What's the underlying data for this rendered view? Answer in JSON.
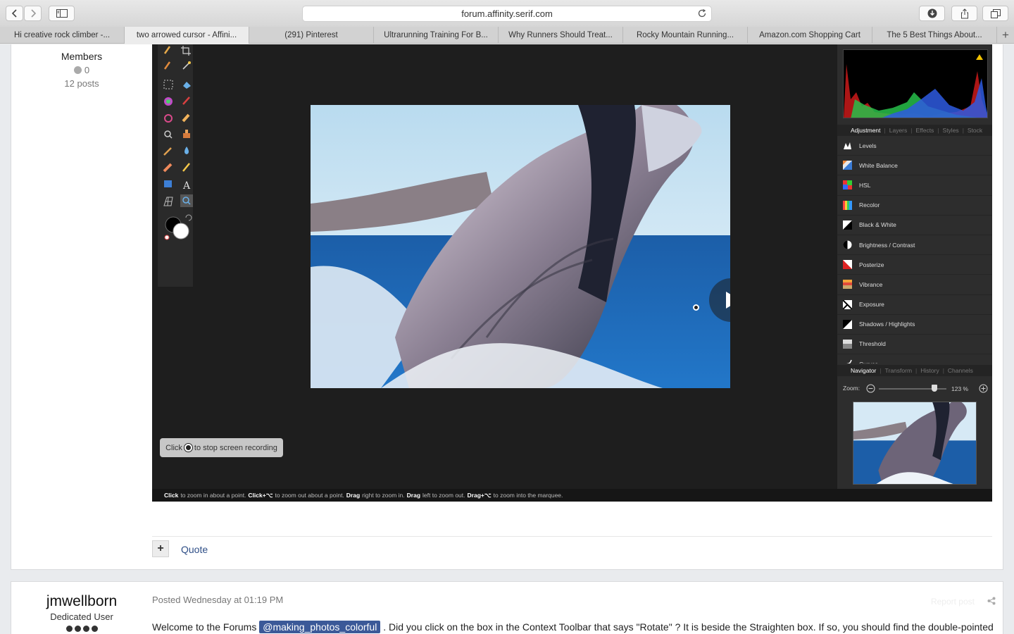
{
  "browser": {
    "url": "forum.affinity.serif.com",
    "tabs": [
      {
        "label": "Hi creative rock climber -...",
        "active": false
      },
      {
        "label": "two arrowed cursor - Affini...",
        "active": true
      },
      {
        "label": "(291) Pinterest",
        "active": false
      },
      {
        "label": "Ultrarunning Training For B...",
        "active": false
      },
      {
        "label": "Why Runners Should Treat...",
        "active": false
      },
      {
        "label": "Rocky Mountain Running...",
        "active": false
      },
      {
        "label": "Amazon.com Shopping Cart",
        "active": false
      },
      {
        "label": "The 5 Best Things About...",
        "active": false
      }
    ],
    "new_tab": "+"
  },
  "post1": {
    "author_role": "Members",
    "reputation": "0",
    "post_count": "12 posts",
    "quote_label": "Quote",
    "plus_label": "+"
  },
  "recording": {
    "stop_prefix": "Click",
    "stop_suffix": "to stop screen recording",
    "status": [
      {
        "t": "Click",
        "b": true
      },
      {
        "t": "to zoom in about a point.",
        "b": false
      },
      {
        "t": "Click+⌥",
        "b": true
      },
      {
        "t": "to zoom out about a point.",
        "b": false
      },
      {
        "t": "Drag",
        "b": true
      },
      {
        "t": "right to zoom in.",
        "b": false
      },
      {
        "t": "Drag",
        "b": true
      },
      {
        "t": "left to zoom out.",
        "b": false
      },
      {
        "t": "Drag+⌥",
        "b": true
      },
      {
        "t": "to zoom into the marquee.",
        "b": false
      }
    ],
    "panel_tabs": [
      {
        "label": "Adjustment",
        "on": true
      },
      {
        "label": "Layers",
        "on": false
      },
      {
        "label": "Effects",
        "on": false
      },
      {
        "label": "Styles",
        "on": false
      },
      {
        "label": "Stock",
        "on": false
      }
    ],
    "adjustments": [
      "Levels",
      "White Balance",
      "HSL",
      "Recolor",
      "Black & White",
      "Brightness / Contrast",
      "Posterize",
      "Vibrance",
      "Exposure",
      "Shadows / Highlights",
      "Threshold",
      "Curves"
    ],
    "nav_tabs": [
      {
        "label": "Navigator",
        "on": true
      },
      {
        "label": "Transform",
        "on": false
      },
      {
        "label": "History",
        "on": false
      },
      {
        "label": "Channels",
        "on": false
      }
    ],
    "zoom_label": "Zoom:",
    "zoom_value": "123 %",
    "zoom_slider_fraction": 0.82
  },
  "post2": {
    "username": "jmwellborn",
    "user_title": "Dedicated User",
    "posted": "Posted Wednesday at 01:19 PM",
    "report": "Report post",
    "text_before": "Welcome to the Forums",
    "mention": "@making_photos_colorful",
    "text_after": ". Did you click on the box in the Context Toolbar that says \"Rotate\" ? It is beside the Straighten box. If so, you should find the double-pointed"
  },
  "colors": {
    "mention": "#3b5998",
    "quote_link": "#2f4f87",
    "accent": "#ffffff"
  }
}
